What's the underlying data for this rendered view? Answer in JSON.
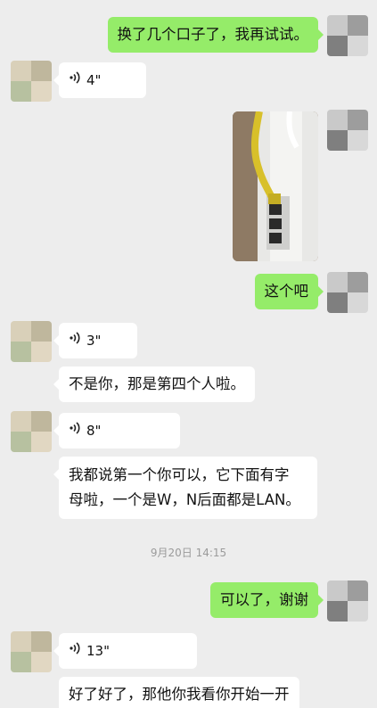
{
  "messages": [
    {
      "side": "right",
      "type": "text",
      "text": "换了几个口子了，我再试试。"
    },
    {
      "side": "left",
      "type": "voice",
      "duration": "4\""
    },
    {
      "side": "right",
      "type": "image"
    },
    {
      "side": "right",
      "type": "text",
      "text": "这个吧"
    },
    {
      "side": "left",
      "type": "voice",
      "duration": "3\""
    },
    {
      "side": "left",
      "type": "text",
      "text": "不是你，那是第四个人啦。"
    },
    {
      "side": "left",
      "type": "voice",
      "duration": "8\""
    },
    {
      "side": "left",
      "type": "text",
      "lines": [
        "我都说第一个你可以，它下面有字",
        "母啦，一个是W，N后面都是LAN。"
      ]
    },
    {
      "side": "center",
      "type": "timestamp",
      "text": "9月20日 14:15"
    },
    {
      "side": "right",
      "type": "text",
      "text": "可以了，谢谢"
    },
    {
      "side": "left",
      "type": "voice",
      "duration": "13\""
    },
    {
      "side": "left",
      "type": "text",
      "text": "好了好了，那他你我看你开始一开"
    }
  ],
  "colors": {
    "background": "#ededed",
    "bubble_self": "#95ec69",
    "bubble_other": "#ffffff",
    "timestamp": "#9b9b9b"
  },
  "icons": {
    "voice": "voice-wave-icon",
    "avatar": "blurred-avatar"
  }
}
